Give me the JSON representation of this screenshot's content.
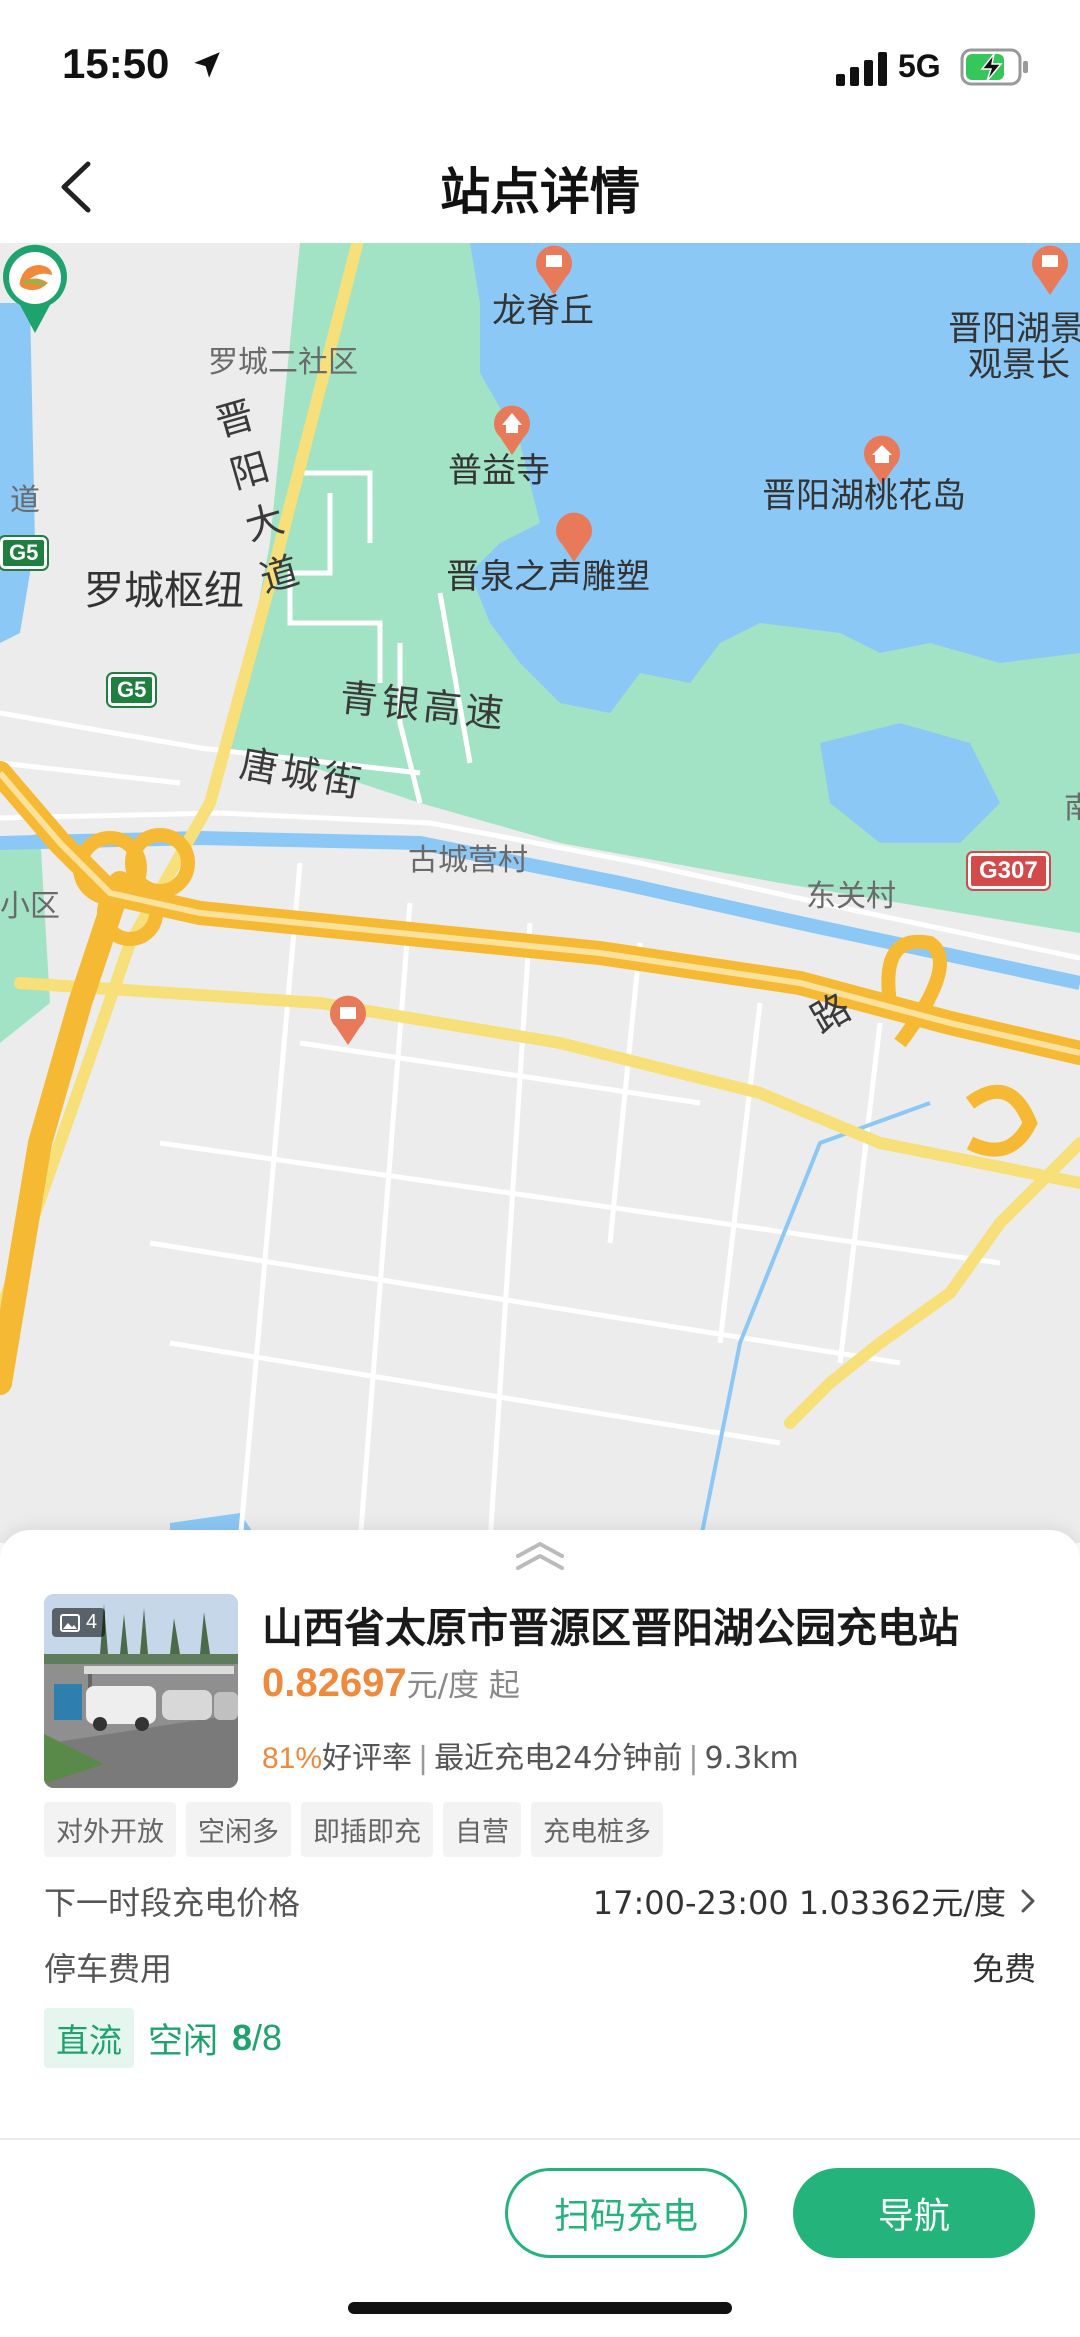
{
  "status_bar": {
    "time": "15:50",
    "network": "5G"
  },
  "header": {
    "title": "站点详情"
  },
  "map": {
    "labels": {
      "longjiqiu": "龙脊丘",
      "jinyanghu_a": "晋阳湖景",
      "jinyanghu_b": "观景长",
      "luocheng_erse": "罗城二社区",
      "jinyang_dadao": "晋阳大道",
      "puyisi": "普益寺",
      "taohuadao": "晋阳湖桃花岛",
      "dao": "道",
      "jinquan": "晋泉之声雕塑",
      "luocheng_shuniu": "罗城枢纽",
      "qingyin": "青银高速",
      "tangcheng": "唐城街",
      "guchengying": "古城营村",
      "dongguan": "东关村",
      "xiaoqu": "小区",
      "lu": "路",
      "road_fragment": "南"
    },
    "shields": {
      "g5_a": "G5",
      "g5_b": "G5",
      "g307": "G307"
    }
  },
  "station": {
    "photo_count": "4",
    "name": "山西省太原市晋源区晋阳湖公园充电站",
    "price_value": "0.82697",
    "price_unit": "元/度 起",
    "rating": "81%",
    "rating_label": "好评率",
    "last_charge": "最近充电24分钟前",
    "distance": "9.3km",
    "tags": [
      "对外开放",
      "空闲多",
      "即插即充",
      "自营",
      "充电桩多"
    ],
    "next_price_label": "下一时段充电价格",
    "next_price_value": "17:00-23:00 1.03362元/度",
    "parking_label": "停车费用",
    "parking_value": "免费",
    "dc_label": "直流",
    "idle_label": "空闲",
    "idle_available": "8",
    "idle_total": "/8"
  },
  "actions": {
    "scan_label": "扫码充电",
    "nav_label": "导航"
  },
  "colors": {
    "accent": "#23b37b",
    "price": "#ef8a3c",
    "water": "#8cc8f5",
    "park": "#a3e3c5",
    "highway": "#f6b933"
  }
}
